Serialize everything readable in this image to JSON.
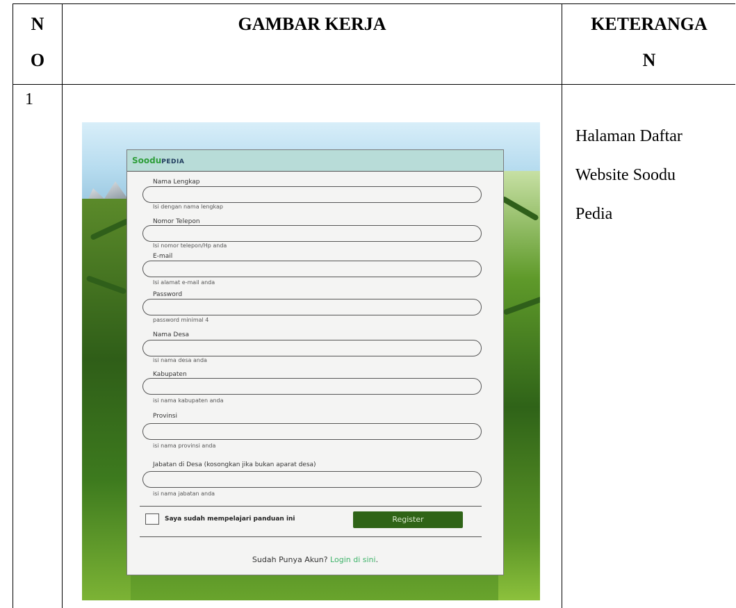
{
  "table": {
    "headers": {
      "no_line1": "N",
      "no_line2": "O",
      "gambar": "GAMBAR KERJA",
      "ket_line1": "KETERANGA",
      "ket_line2": "N"
    },
    "row": {
      "number": "1",
      "keterangan_lines": [
        "Halaman Daftar",
        "Website Soodu",
        "Pedia"
      ]
    }
  },
  "form": {
    "brand_main": "Soodu",
    "brand_suffix": "PEDIA",
    "fields": [
      {
        "label": "Nama Lengkap",
        "hint": "Isi dengan nama lengkap"
      },
      {
        "label": "Nomor Telepon",
        "hint": "Isi nomor telepon/Hp anda"
      },
      {
        "label": "E-mail",
        "hint": "Isi alamat e-mail anda"
      },
      {
        "label": "Password",
        "hint": "password minimal 4"
      },
      {
        "label": "Nama Desa",
        "hint": "isi nama desa anda"
      },
      {
        "label": "Kabupaten",
        "hint": "isi nama kabupaten anda"
      },
      {
        "label": "Provinsi",
        "hint": "isi nama provinsi anda"
      },
      {
        "label": "Jabatan di Desa (kosongkan jika bukan aparat desa)",
        "hint": "isi nama jabatan anda"
      }
    ],
    "agree_label": "Saya sudah mempelajari panduan ini",
    "register_label": "Register",
    "footer_text": "Sudah Punya Akun?",
    "footer_link": "Login di sini"
  },
  "colors": {
    "brand_green": "#2e9e3a",
    "button_green": "#2f6417",
    "link_green": "#3fb36a",
    "header_bar": "#b8dcd8"
  }
}
